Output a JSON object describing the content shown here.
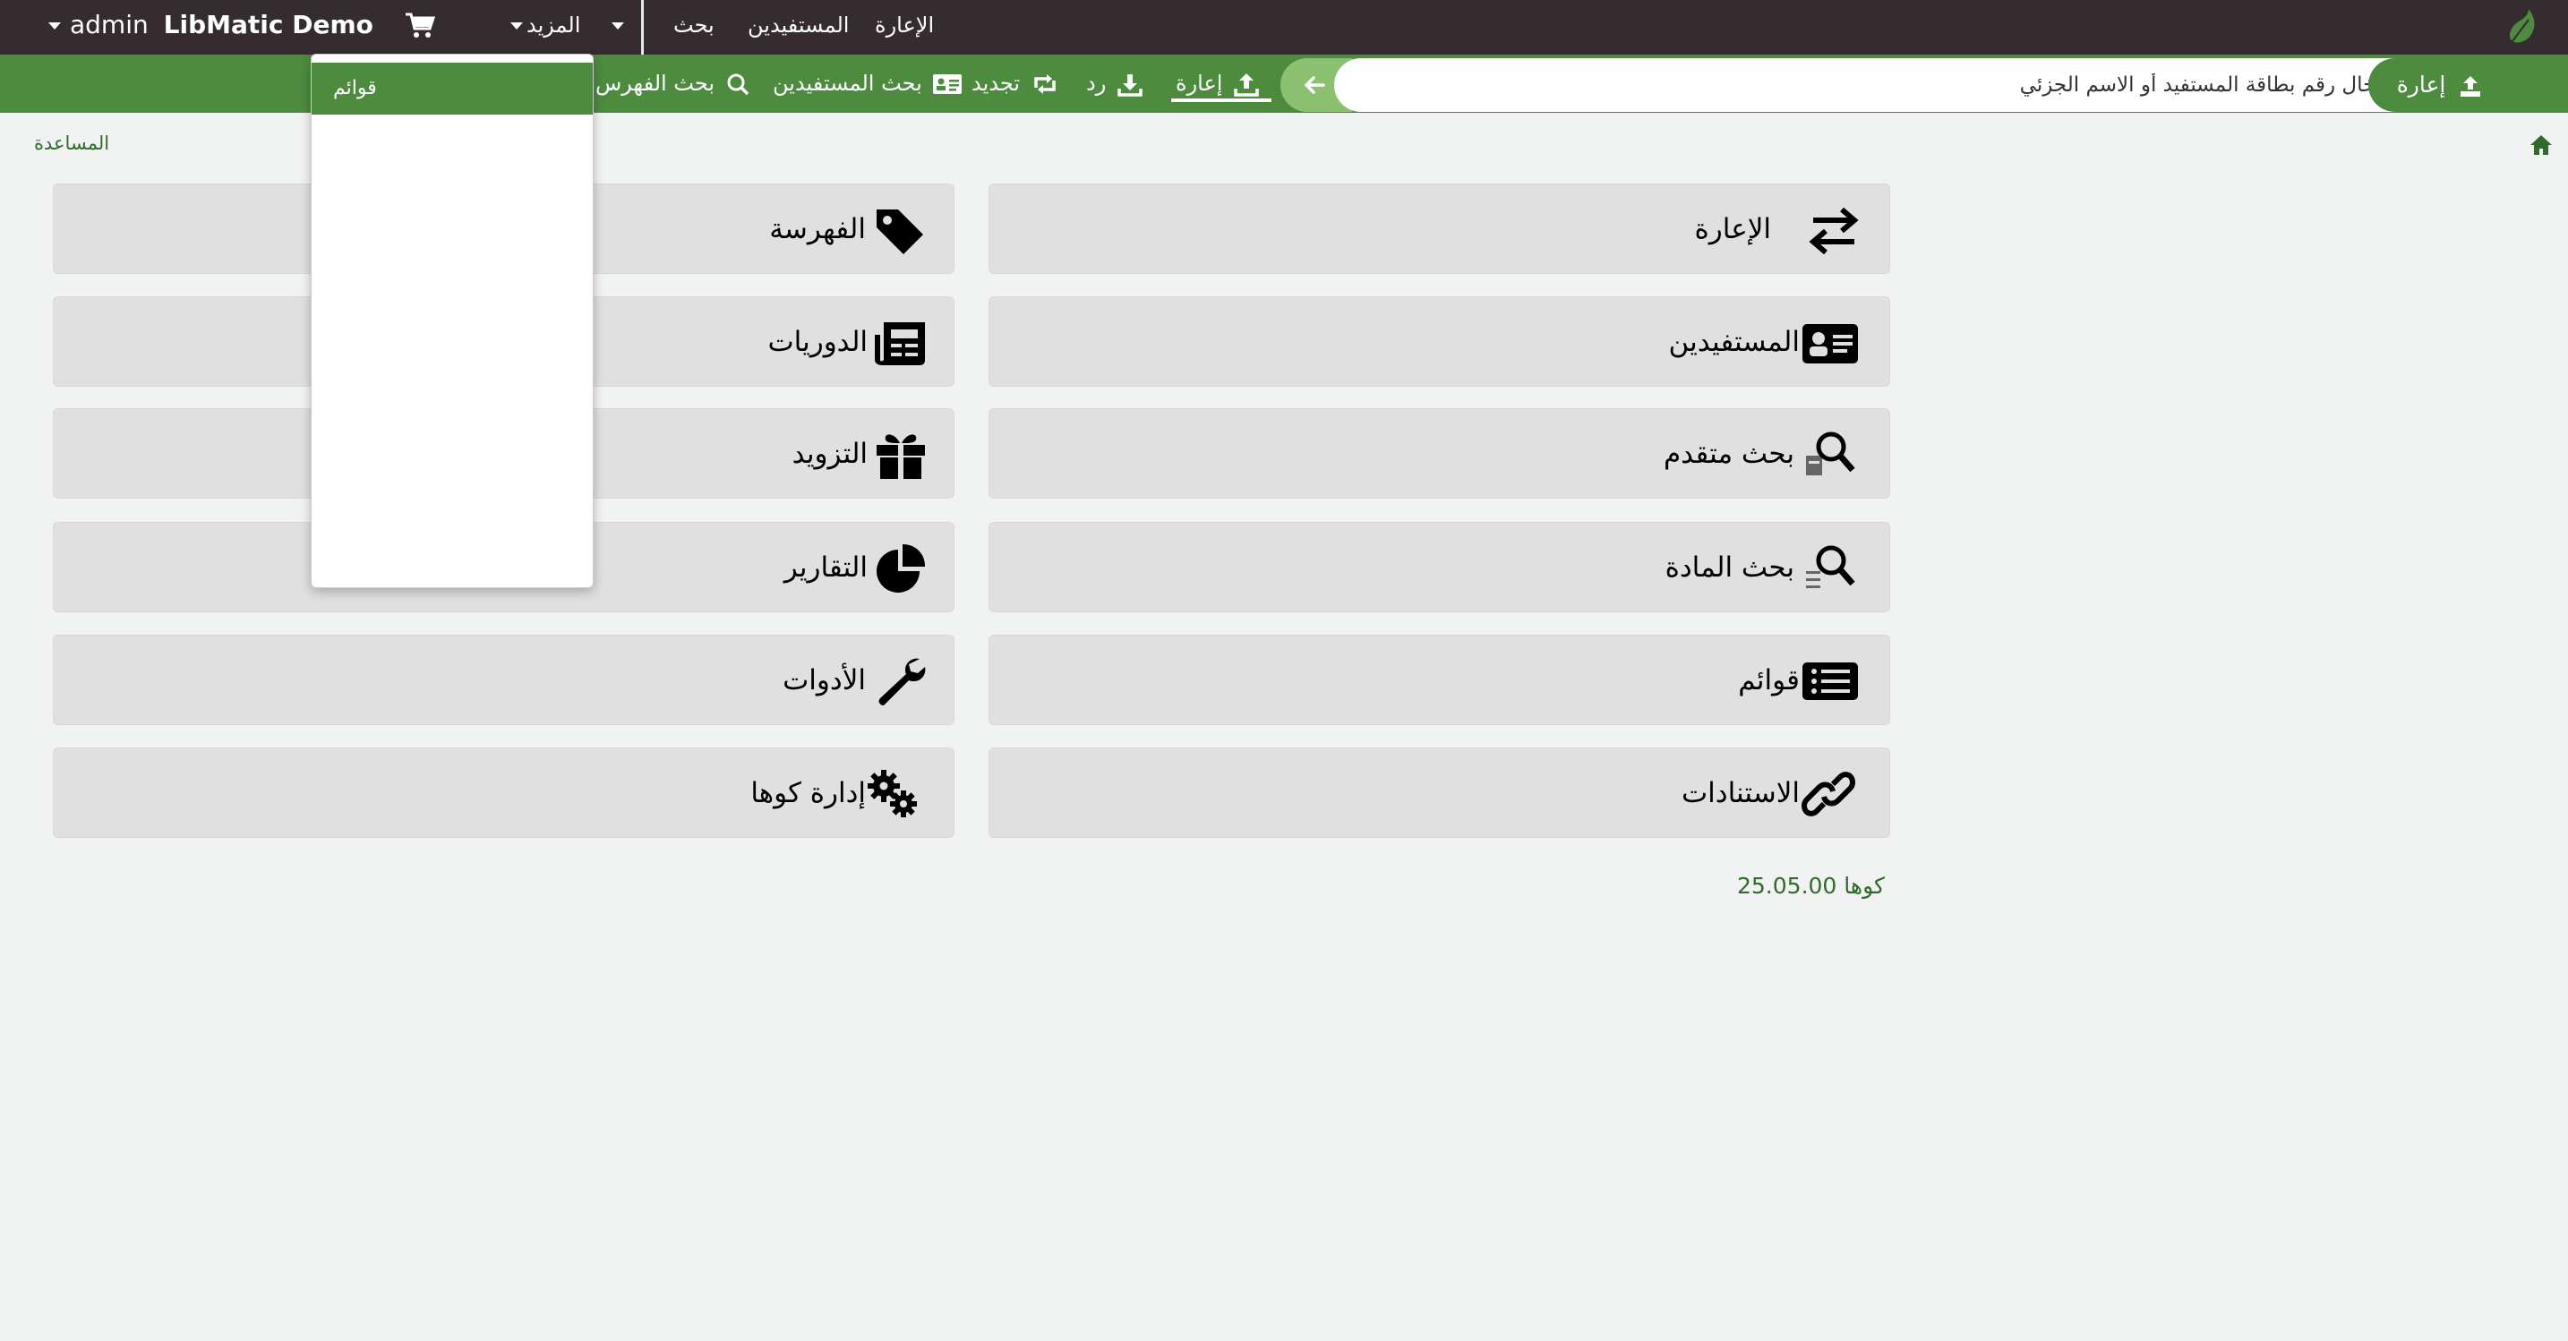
{
  "topnav": {
    "user_label": "admin",
    "library_label": "LibMatic Demo",
    "more_label": "المزيد",
    "search_label": "بحث",
    "patrons_label": "المستفيدين",
    "circulation_label": "الإعارة"
  },
  "searchbar": {
    "checkout_label": "إعارة",
    "placeholder": "إدخال رقم بطاقة المستفيد أو الاسم الجزئي",
    "tools": [
      {
        "label": "إعارة",
        "icon": "upload-icon"
      },
      {
        "label": "رد",
        "icon": "download-icon"
      },
      {
        "label": "تجديد",
        "icon": "renew-icon"
      },
      {
        "label": "بحث المستفيدين",
        "icon": "id-card-icon"
      },
      {
        "label": "بحث الفهرس",
        "icon": "search-icon"
      }
    ]
  },
  "dropdown": {
    "items": [
      "قوائم"
    ]
  },
  "breadcrumb": {
    "help_label": "المساعدة"
  },
  "tiles": {
    "circulation": "الإعارة",
    "patrons": "المستفيدين",
    "advanced_search": "بحث متقدم",
    "item_search": "بحث المادة",
    "lists": "قوائم",
    "authorities": "الاستنادات",
    "cataloging": "الفهرسة",
    "serials": "الدوريات",
    "acquisitions": "التزويد",
    "reports": "التقارير",
    "tools": "الأدوات",
    "koha_admin": "إدارة كوها"
  },
  "footer": {
    "version": "كوها 25.05.00"
  },
  "colors": {
    "topbar": "#342c2f",
    "greenbar": "#4d8b3f",
    "tile_bg": "#e0e0e0",
    "link": "#2f6b2a"
  }
}
